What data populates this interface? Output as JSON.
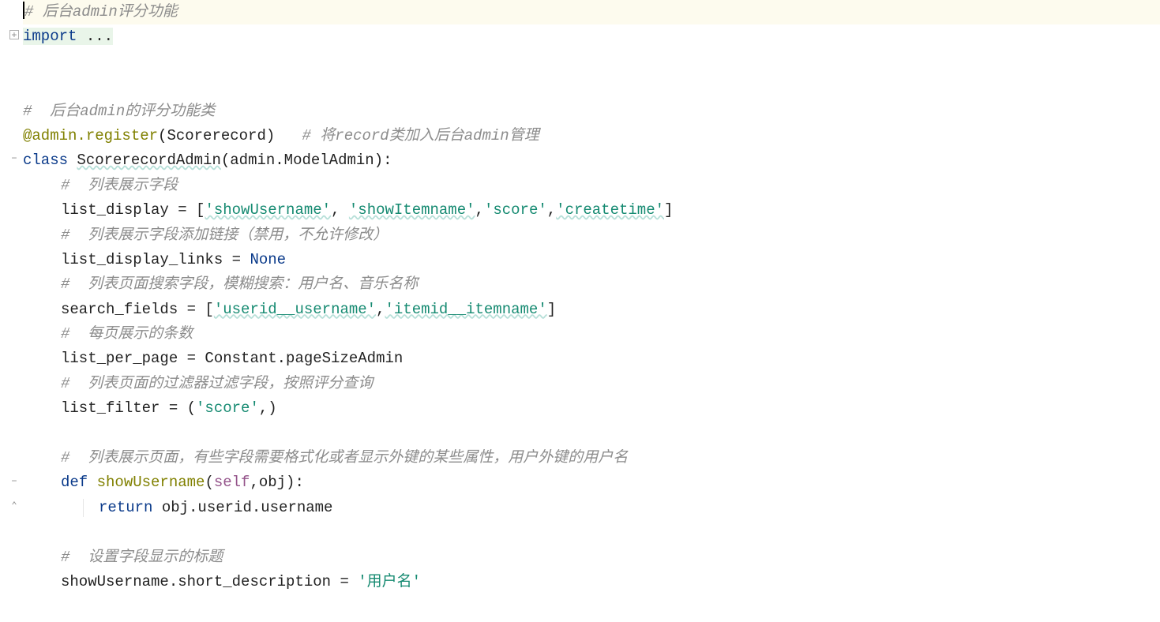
{
  "colors": {
    "comment": "#8c8c8c",
    "keyword": "#0a3a8a",
    "decorator": "#808000",
    "string": "#158a71",
    "self": "#94538a",
    "highlight_line": "#fdfbee",
    "folded_bg": "#e9f5e9"
  },
  "fold_markers": [
    {
      "line": 2,
      "kind": "collapsed"
    },
    {
      "line": 7,
      "kind": "expanded"
    },
    {
      "line": 20,
      "kind": "expanded"
    },
    {
      "line": 21,
      "kind": "close"
    }
  ],
  "lines": {
    "l1": {
      "comment_prefix": "# ",
      "text": "后台admin评分功能"
    },
    "l2": {
      "kw": "import ",
      "folded": "..."
    },
    "l5": {
      "comment_prefix": "# ",
      "text": " 后台admin的评分功能类"
    },
    "l6": {
      "decorator": "@admin.register",
      "open": "(",
      "arg": "Scorerecord",
      "close": ")",
      "spacer": "   ",
      "cmt": "# 将record类加入后台admin管理"
    },
    "l7": {
      "kw_class": "class ",
      "name": "ScorerecordAdmin",
      "rest": "(admin.ModelAdmin):"
    },
    "l8": {
      "cmt": "#  列表展示字段"
    },
    "l9": {
      "lhs": "list_display = [",
      "s1": "'showUsername'",
      "c1": ", ",
      "s2": "'showItemname'",
      "c2": ",",
      "s3": "'score'",
      "c3": ",",
      "s4": "'createtime'",
      "rb": "]"
    },
    "l10": {
      "cmt": "#  列表展示字段添加链接（禁用，不允许修改）"
    },
    "l11": {
      "lhs": "list_display_links = ",
      "none": "None"
    },
    "l12": {
      "cmt": "#  列表页面搜索字段，模糊搜索：用户名、音乐名称"
    },
    "l13": {
      "lhs": "search_fields = [",
      "s1": "'userid__username'",
      "c1": ",",
      "s2": "'itemid__itemname'",
      "rb": "]"
    },
    "l14": {
      "cmt": "#  每页展示的条数"
    },
    "l15": {
      "text": "list_per_page = Constant.pageSizeAdmin"
    },
    "l16": {
      "cmt": "#  列表页面的过滤器过滤字段，按照评分查询"
    },
    "l17": {
      "lhs": "list_filter = (",
      "s1": "'score'",
      "rb": ",)"
    },
    "l19": {
      "cmt": "#  列表展示页面，有些字段需要格式化或者显示外键的某些属性，用户外键的用户名"
    },
    "l20": {
      "kw_def": "def ",
      "name": "showUsername",
      "open": "(",
      "self": "self",
      "rest": ",obj):"
    },
    "l21": {
      "kw_return": "return ",
      "rest": "obj.userid.username"
    },
    "l23": {
      "cmt": "#  设置字段显示的标题"
    },
    "l24": {
      "lhs": "showUsername.short_description = ",
      "s1": "'用户名'"
    }
  }
}
